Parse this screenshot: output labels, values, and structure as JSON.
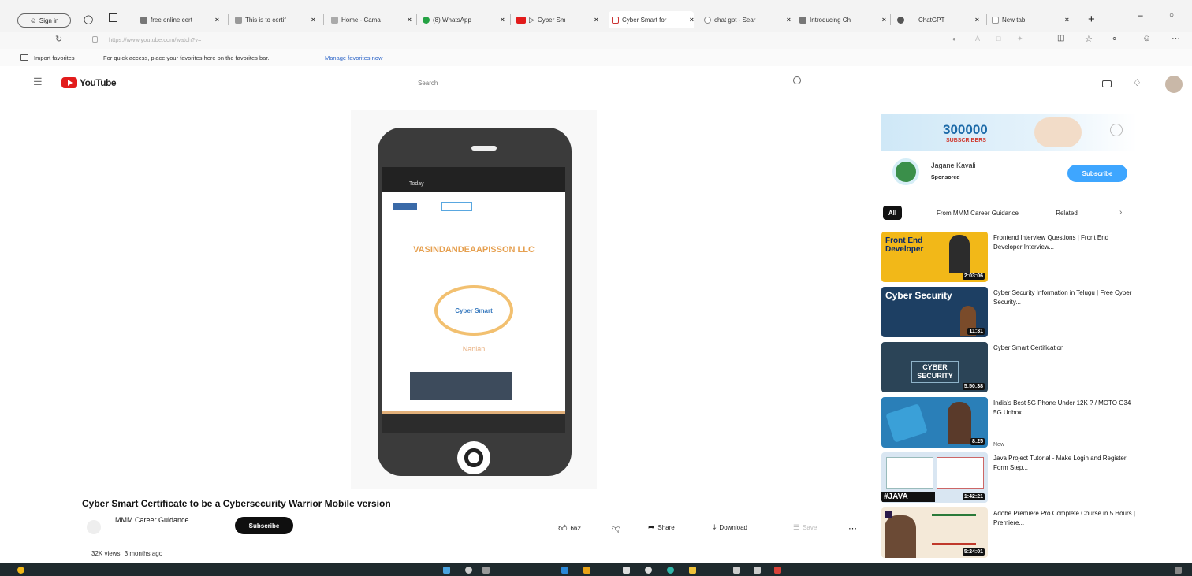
{
  "browser": {
    "sign_in_label": "Sign in",
    "tabs": [
      {
        "label": "free online cert",
        "color": "#777777"
      },
      {
        "label": "This is to certif",
        "color": "#999999"
      },
      {
        "label": "Home - Cama",
        "color": "#aaaaaa"
      },
      {
        "label": "(8) WhatsApp",
        "color": "#25a244"
      },
      {
        "label": "Cyber Sm",
        "color": "#e21b1b"
      },
      {
        "label": "Cyber Smart for",
        "color": "#cc3333"
      },
      {
        "label": "chat gpt - Sear",
        "color": "#888888"
      },
      {
        "label": "Introducing Ch",
        "color": "#777777"
      },
      {
        "label": "ChatGPT",
        "color": "#555555"
      },
      {
        "label": "New tab",
        "color": "#999999"
      }
    ],
    "url": "https://www.youtube.com/watch?v=",
    "favorites": {
      "import_label": "Import favorites",
      "hint": "For quick access, place your favorites here on the favorites bar.",
      "manage_link": "Manage favorites now"
    }
  },
  "youtube": {
    "logo_text": "YouTube",
    "search_placeholder": "Search",
    "video": {
      "title": "Cyber Smart Certificate to be a Cybersecurity Warrior Mobile version",
      "channel": "MMM Career Guidance",
      "subscribe_label": "Subscribe",
      "likes": "662",
      "share_label": "Share",
      "download_label": "Download",
      "save_label": "Save",
      "views": "32K views",
      "age": "3 months ago",
      "phone_screen": {
        "bar_label": "Today",
        "company": "VASINDANDEAAPISSON LLC",
        "seal_text": "Cyber Smart",
        "name_line": "Nanlan"
      }
    },
    "ad": {
      "banner_number": "300000",
      "banner_label": "SUBSCRIBERS",
      "channel": "Jagane Kavali",
      "sponsored_label": "Sponsored",
      "subscribe_label": "Subscribe"
    },
    "chips": [
      {
        "label": "All",
        "active": true
      },
      {
        "label": "From MMM Career Guidance",
        "active": false
      },
      {
        "label": "Related",
        "active": false
      }
    ],
    "recommendations": [
      {
        "title": "Frontend Interview Questions | Front End Developer Interview...",
        "channel": "",
        "meta": "",
        "duration": "2:03:06",
        "thumb_text": "Front End Developer",
        "thumb_bg": "#f2b818",
        "thumb_fg": "#0a2a6b"
      },
      {
        "title": "Cyber Security Information in Telugu | Free Cyber Security...",
        "channel": "",
        "meta": "",
        "duration": "11:31",
        "thumb_text": "Cyber Security",
        "thumb_bg": "#1d3f63",
        "thumb_fg": "#ffffff"
      },
      {
        "title": "Cyber Smart Certification",
        "channel": "",
        "meta": "",
        "duration": "5:50:38",
        "thumb_text": "CYBER SECURITY",
        "thumb_bg": "#2b4457",
        "thumb_fg": "#ffffff"
      },
      {
        "title": "India's Best 5G Phone Under 12K ? / MOTO G34 5G Unbox...",
        "channel": "",
        "meta": "New",
        "duration": "8:25",
        "thumb_text": "",
        "thumb_bg": "#2a7fb8",
        "thumb_fg": "#ffffff"
      },
      {
        "title": "Java Project Tutorial - Make Login and Register Form Step...",
        "channel": "",
        "meta": "",
        "duration": "1:42:21",
        "thumb_text": "#JAVA",
        "thumb_bg": "#d9e6f2",
        "thumb_fg": "#111111"
      },
      {
        "title": "Adobe Premiere Pro Complete Course in 5 Hours | Premiere...",
        "channel": "",
        "meta": "",
        "duration": "5:24:01",
        "thumb_text": "",
        "thumb_bg": "#f4e9d8",
        "thumb_fg": "#c0392b"
      }
    ]
  },
  "colors": {
    "youtube_red": "#e21b1b",
    "subscribe_ad": "#3ea6ff",
    "taskbar": "#1f2a2e"
  }
}
